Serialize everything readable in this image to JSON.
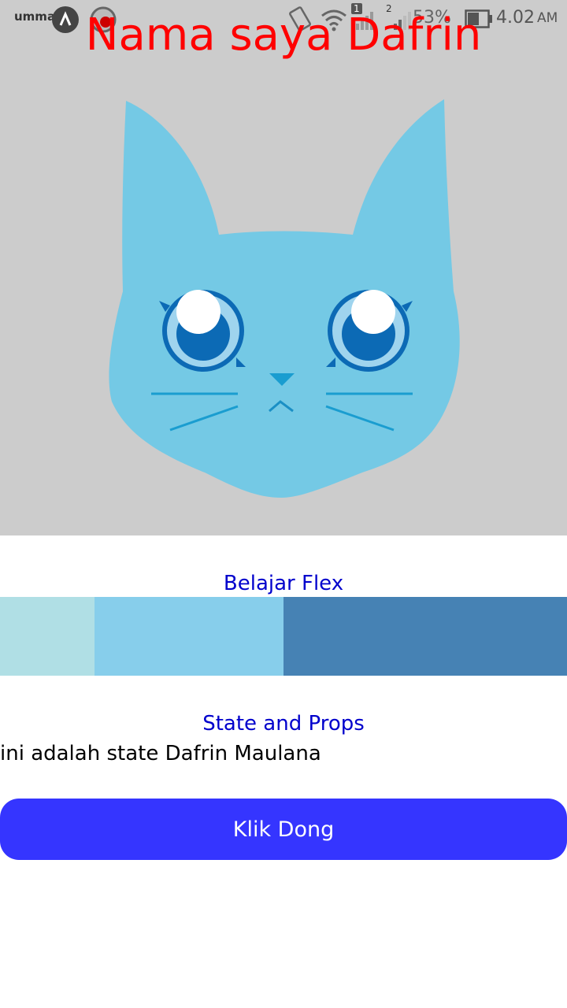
{
  "status_bar": {
    "carrier_label": "umma",
    "battery_percent": "53%",
    "sim1_badge": "1",
    "sim2_badge": "2",
    "time": "4.02",
    "ampm": "AM"
  },
  "header": {
    "title": "Nama saya Dafrin"
  },
  "image": {
    "icon": "cat-face-icon",
    "background_color": "#cccccc",
    "cat_color": "#74c9e5",
    "eye_color": "#0c6ab5"
  },
  "flex_section": {
    "title": "Belajar Flex",
    "boxes": [
      {
        "color": "#b0dfe5"
      },
      {
        "color": "#87ceeb"
      },
      {
        "color": "#4682b4"
      }
    ]
  },
  "state_section": {
    "title": "State and Props",
    "state_text": "ini adalah state Dafrin Maulana"
  },
  "button": {
    "label": "Klik Dong",
    "color": "#3535ff"
  }
}
